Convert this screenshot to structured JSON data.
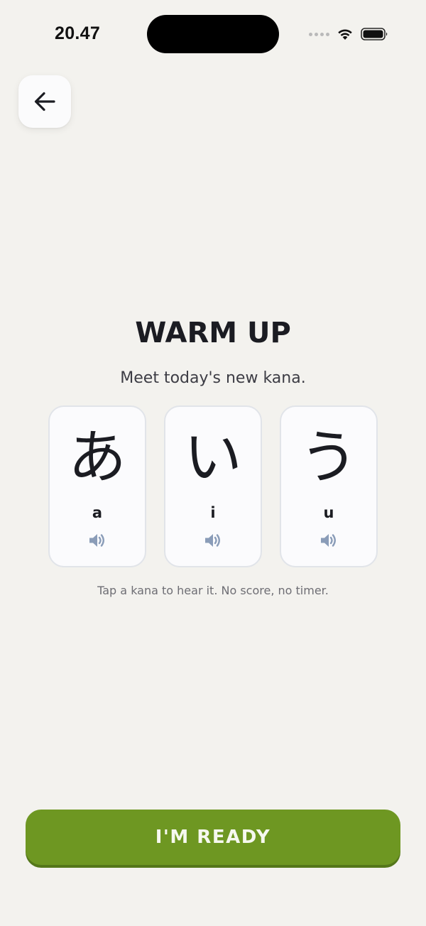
{
  "status_bar": {
    "time": "20.47"
  },
  "header": {
    "back_icon": "arrow-left-icon"
  },
  "main": {
    "title": "WARM UP",
    "subtitle": "Meet today's new kana.",
    "cards": [
      {
        "kana": "あ",
        "romaji": "a",
        "icon": "speaker-icon"
      },
      {
        "kana": "い",
        "romaji": "i",
        "icon": "speaker-icon"
      },
      {
        "kana": "う",
        "romaji": "u",
        "icon": "speaker-icon"
      }
    ],
    "hint": "Tap a kana to hear it. No score, no timer."
  },
  "footer": {
    "ready_label": "I'M READY"
  },
  "colors": {
    "background": "#f3f2ee",
    "accent_green": "#6e9722",
    "speaker_blue": "#8a9cb8"
  }
}
